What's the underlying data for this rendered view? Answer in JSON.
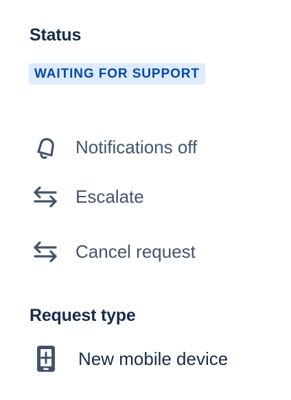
{
  "status": {
    "heading": "Status",
    "value": "WAITING FOR SUPPORT",
    "badge_bg": "#deebff",
    "badge_text_color": "#0747a6"
  },
  "actions": [
    {
      "label": "Notifications off",
      "icon": "bell-off-icon"
    },
    {
      "label": "Escalate",
      "icon": "swap-arrows-icon"
    },
    {
      "label": "Cancel request",
      "icon": "swap-arrows-icon"
    }
  ],
  "request_type": {
    "heading": "Request type",
    "value": "New mobile device",
    "icon": "mobile-device-icon"
  },
  "colors": {
    "heading": "#172b4d",
    "text": "#42526e"
  }
}
